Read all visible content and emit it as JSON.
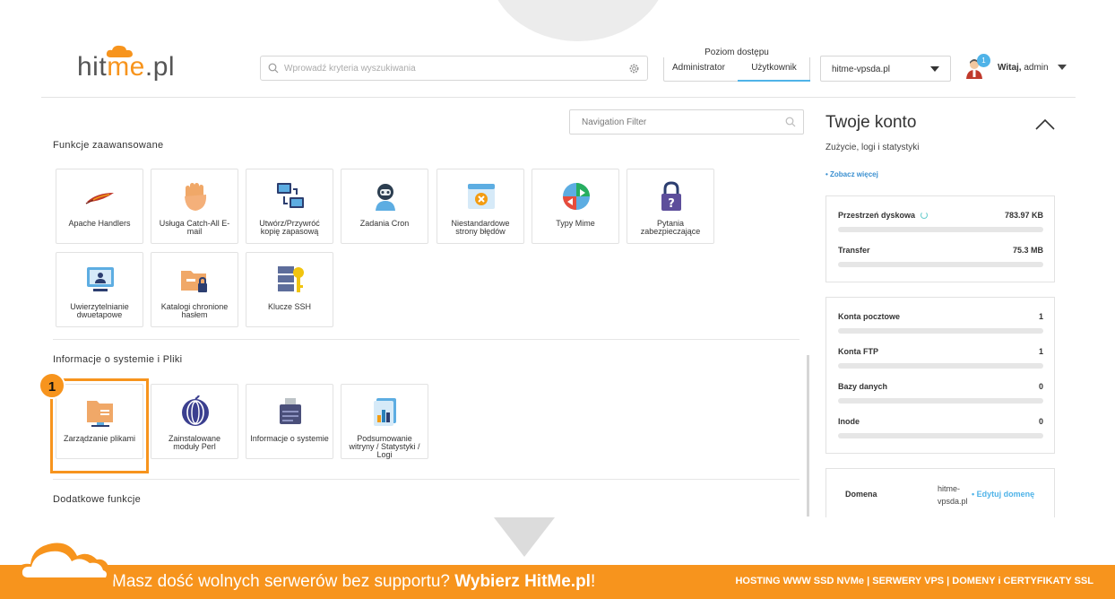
{
  "header": {
    "logo_prefix": "hit",
    "logo_accent": "me",
    "logo_suffix": ".pl",
    "search_placeholder": "Wprowadź kryteria wyszukiwania",
    "access_label": "Poziom dostępu",
    "access_admin": "Administrator",
    "access_user": "Użytkownik",
    "domain_selected": "hitme-vpsda.pl",
    "notification_count": "1",
    "greeting_bold": "Witaj,",
    "greeting_user": " admin"
  },
  "nav_filter_placeholder": "Navigation Filter",
  "sections": {
    "advanced_title": "Funkcje zaawansowane",
    "advanced_tiles": [
      "Apache Handlers",
      "Usługa Catch-All E-mail",
      "Utwórz/Przywróć kopię zapasową",
      "Zadania Cron",
      "Niestandardowe strony błędów",
      "Typy Mime",
      "Pytania zabezpieczające",
      "Uwierzytelnianie dwuetapowe",
      "Katalogi chronione hasłem",
      "Klucze SSH"
    ],
    "system_title": "Informacje o systemie i Pliki",
    "system_tiles": [
      "Zarządzanie plikami",
      "Zainstalowane moduły Perl",
      "Informacje o systemie",
      "Podsumowanie witryny / Statystyki / Logi"
    ],
    "extra_title": "Dodatkowe funkcje"
  },
  "step_marker": "1",
  "account_panel": {
    "title": "Twoje konto",
    "subtitle": "Zużycie, logi i statystyki",
    "more_link": "• Zobacz więcej",
    "usage": [
      {
        "label": "Przestrzeń dyskowa",
        "value": "783.97 KB"
      },
      {
        "label": "Transfer",
        "value": "75.3 MB"
      }
    ],
    "counts": [
      {
        "label": "Konta pocztowe",
        "value": "1"
      },
      {
        "label": "Konta FTP",
        "value": "1"
      },
      {
        "label": "Bazy danych",
        "value": "0"
      },
      {
        "label": "Inode",
        "value": "0"
      }
    ],
    "domain_label": "Domena",
    "domain_value": "hitme-vpsda.pl",
    "domain_edit": "• Edytuj domenę"
  },
  "footer": {
    "message": "Masz dość wolnych serwerów bez supportu? ",
    "message_bold": "Wybierz HitMe.pl",
    "message_end": "!",
    "right": "HOSTING WWW SSD NVMe | SERWERY VPS | DOMENY i CERTYFIKATY SSL"
  },
  "colors": {
    "accent": "#f7941d",
    "link": "#4fb3e8"
  }
}
